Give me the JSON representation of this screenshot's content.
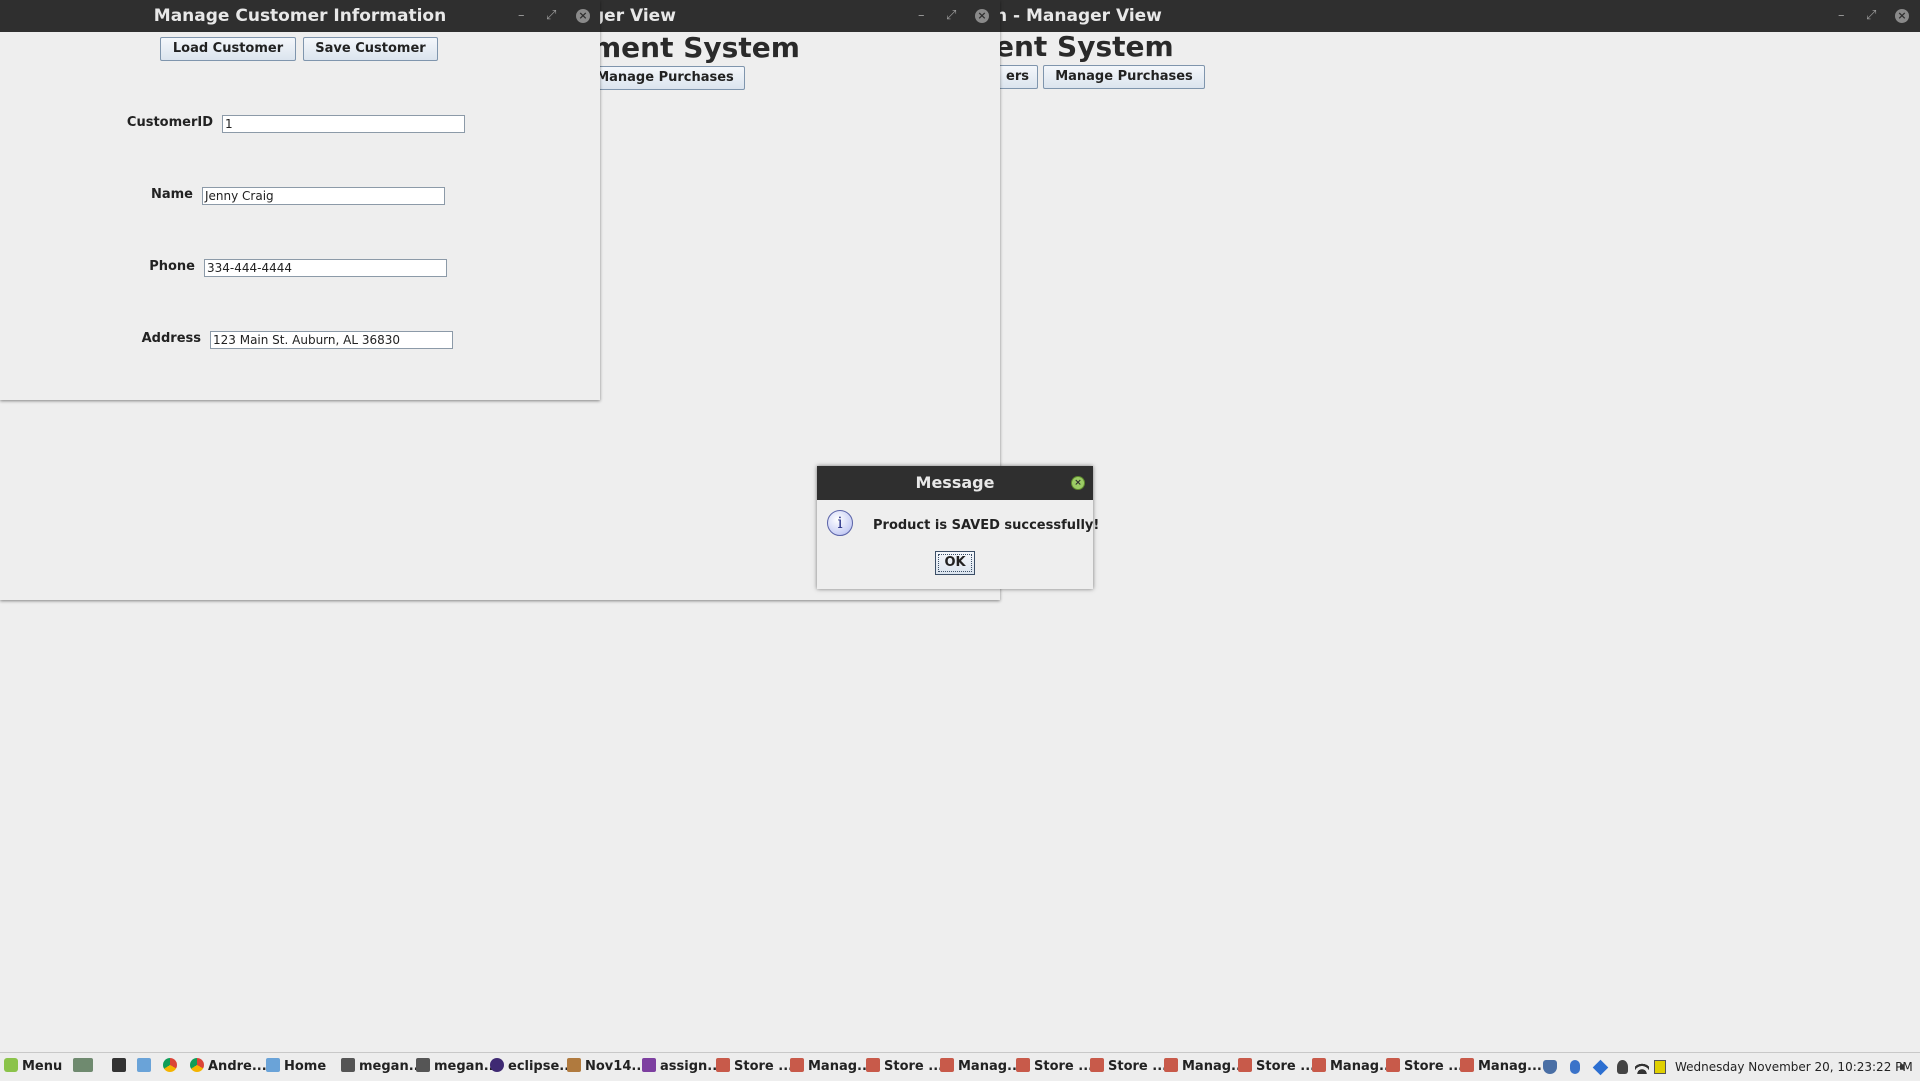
{
  "window_back": {
    "title_fragment": "n - Manager View",
    "system_title_fragment": "ent System",
    "btn_partial": "ers",
    "btn_manage_purchases": "Manage Purchases"
  },
  "window_middle": {
    "title_fragment": "ger View",
    "system_title_fragment": "ment System",
    "btn_manage_purchases": "Manage Purchases"
  },
  "customer_window": {
    "title": "Manage Customer Information",
    "load_label": "Load Customer",
    "save_label": "Save Customer",
    "fields": {
      "customer_id": {
        "label": "CustomerID",
        "value": "1"
      },
      "name": {
        "label": "Name",
        "value": "Jenny Craig"
      },
      "phone": {
        "label": "Phone",
        "value": "334-444-4444"
      },
      "address": {
        "label": "Address",
        "value": "123 Main St. Auburn, AL 36830"
      }
    }
  },
  "dialog": {
    "title": "Message",
    "message": "Product is SAVED successfully!",
    "ok_label": "OK",
    "icon": "info-icon"
  },
  "taskbar": {
    "menu_label": "Menu",
    "items": [
      {
        "label": "Andre...",
        "icon": "chrome-icon"
      },
      {
        "label": "Home",
        "icon": "folder-icon"
      },
      {
        "label": "megan...",
        "icon": "terminal-icon"
      },
      {
        "label": "megan...",
        "icon": "terminal-icon"
      },
      {
        "label": "eclipse...",
        "icon": "eclipse-icon"
      },
      {
        "label": "Nov14....",
        "icon": "archive-icon"
      },
      {
        "label": "assign...",
        "icon": "document-icon"
      },
      {
        "label": "Store ...",
        "icon": "java-icon"
      },
      {
        "label": "Manag...",
        "icon": "java-icon"
      },
      {
        "label": "Store ...",
        "icon": "java-icon"
      },
      {
        "label": "Manag...",
        "icon": "java-icon"
      },
      {
        "label": "Store ...",
        "icon": "java-icon"
      },
      {
        "label": "Store ...",
        "icon": "java-icon"
      },
      {
        "label": "Manag...",
        "icon": "java-icon"
      },
      {
        "label": "Store ...",
        "icon": "java-icon"
      },
      {
        "label": "Manag...",
        "icon": "java-icon"
      },
      {
        "label": "Store ...",
        "icon": "java-icon"
      },
      {
        "label": "Manag...",
        "icon": "java-icon"
      }
    ],
    "clock": "Wednesday November 20, 10:23:22 PM"
  },
  "colors": {
    "titlebar": "#2f2f2f",
    "window_bg": "#eeeeee",
    "button_border": "#7f95ad"
  }
}
